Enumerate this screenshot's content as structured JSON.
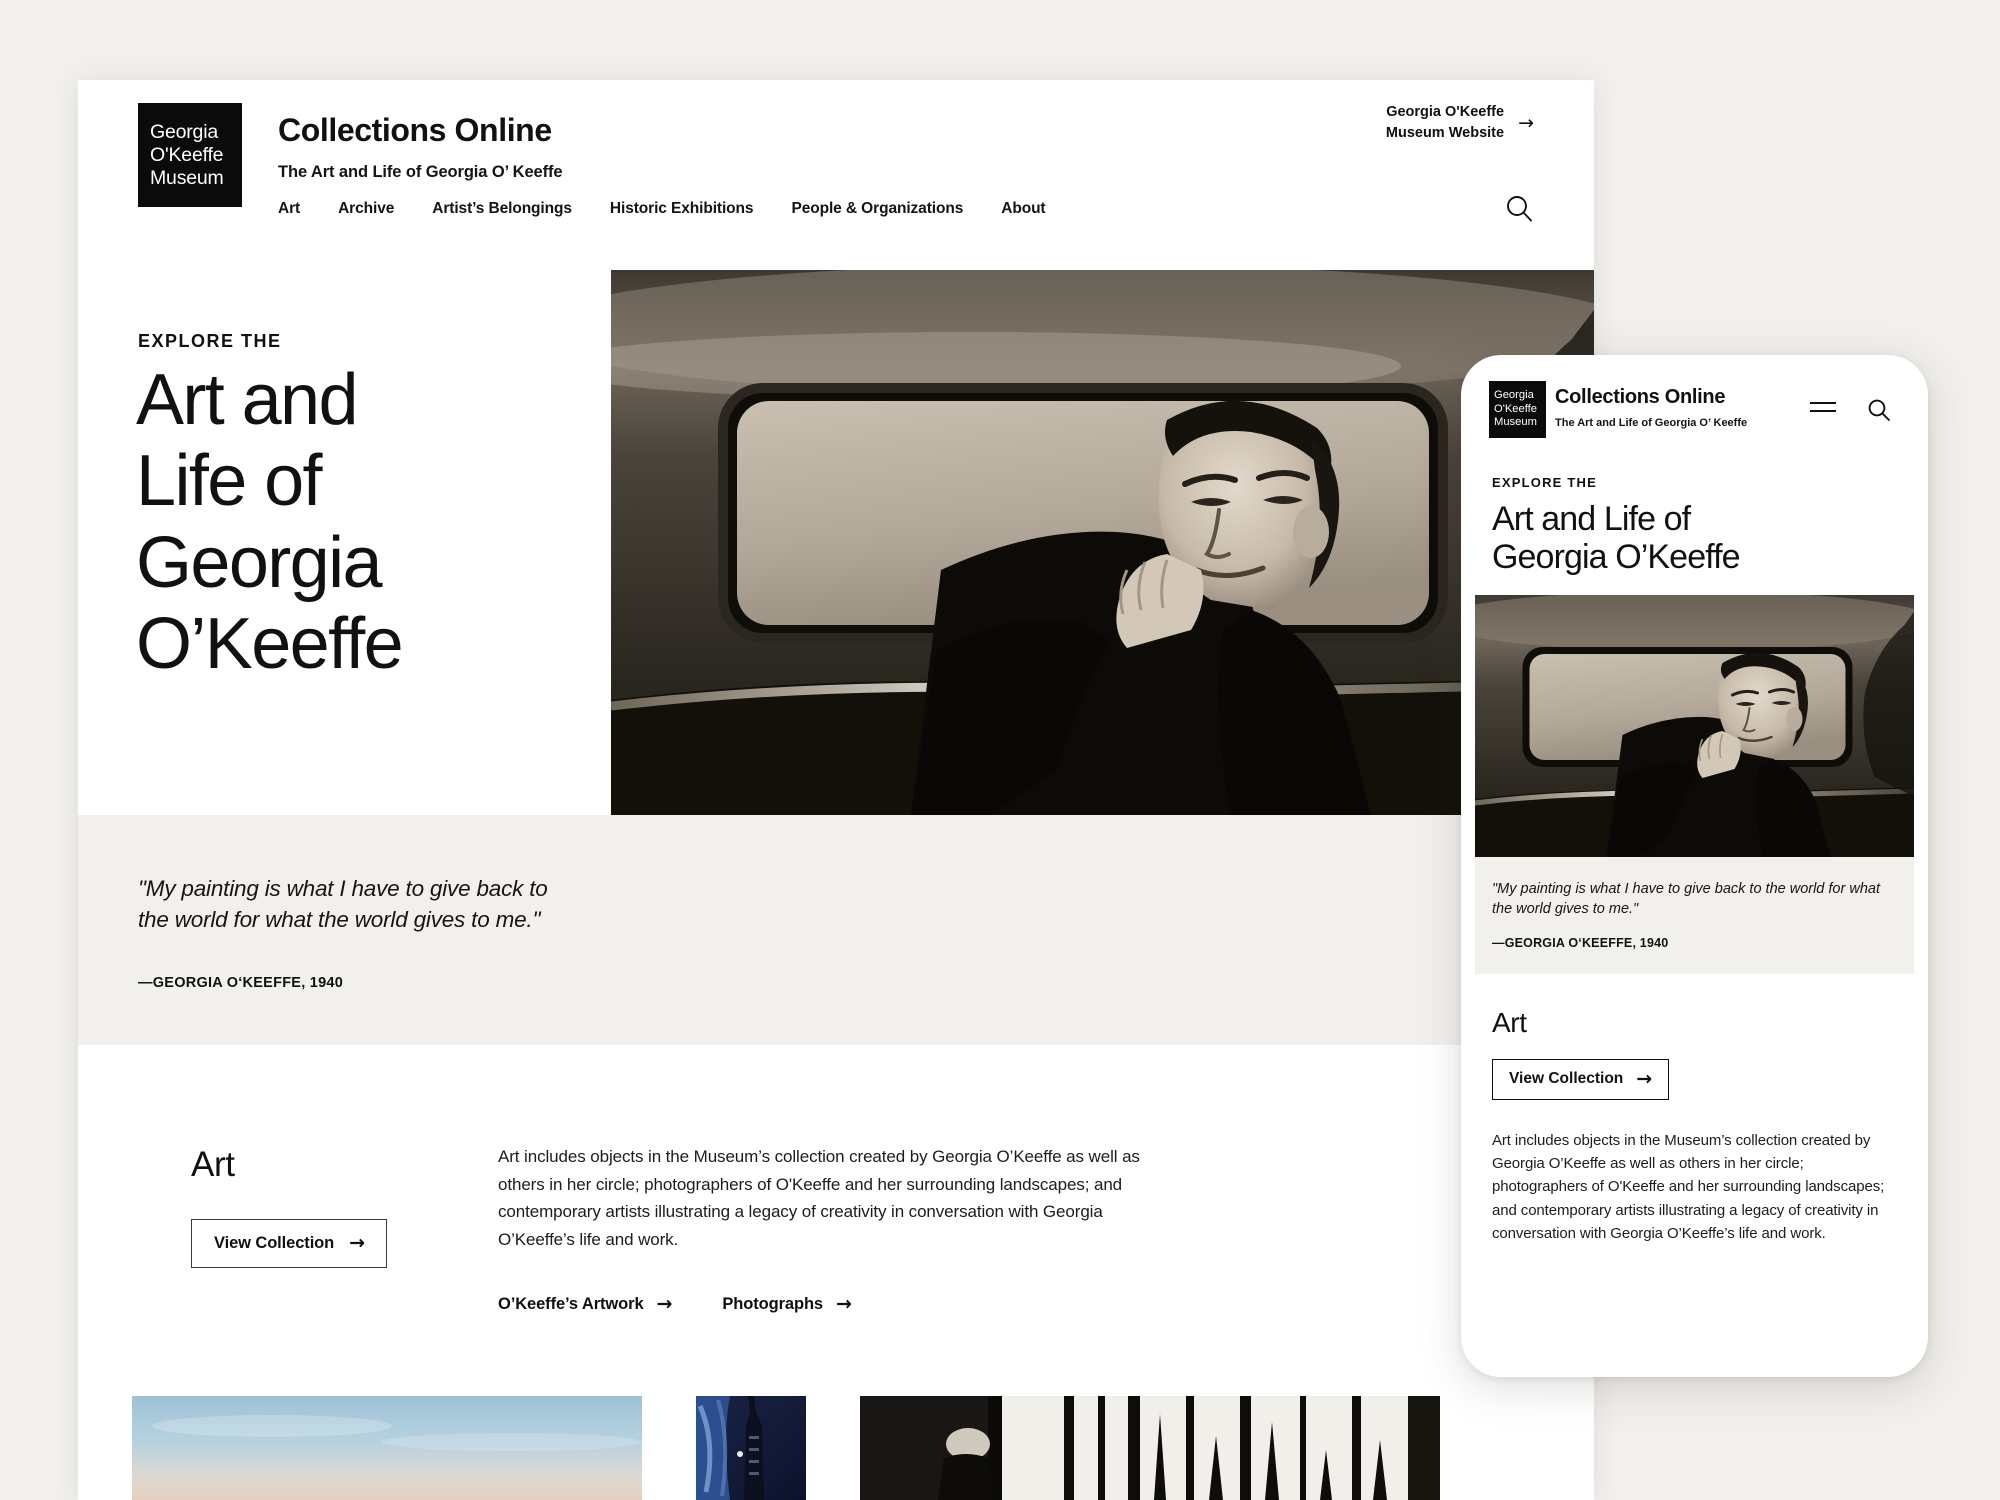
{
  "page": {
    "background_color": "#f2f0ec",
    "accent_color": "#0b0b0b"
  },
  "logo": {
    "line1": "Georgia",
    "line2": "O'Keeffe",
    "line3": "Museum"
  },
  "header": {
    "title": "Collections Online",
    "subtitle": "The Art and Life of Georgia O’ Keeffe",
    "museum_link": {
      "line1": "Georgia O'Keeffe",
      "line2": "Museum Website",
      "arrow": "→"
    },
    "search_icon": "search-icon"
  },
  "nav": {
    "items": [
      {
        "label": "Art"
      },
      {
        "label": "Archive"
      },
      {
        "label": "Artist’s Belongings"
      },
      {
        "label": "Historic Exhibitions"
      },
      {
        "label": "People & Organizations"
      },
      {
        "label": "About"
      }
    ]
  },
  "hero": {
    "eyebrow": "EXPLORE THE",
    "headline_desktop": "Art and\nLife of\nGeorgia\nO’Keeffe",
    "headline_mobile": "Art and Life of\nGeorgia O’Keeffe",
    "image_alt": "Black and white photograph of Georgia O'Keeffe seated in a car, chin resting on her hand"
  },
  "quote": {
    "text": "\"My painting is what I have to give back to the world for what the world gives to me.\"",
    "attribution": "—GEORGIA O‘KEEFFE, 1940"
  },
  "art_section": {
    "title": "Art",
    "button_label": "View Collection",
    "button_arrow": "→",
    "paragraph": "Art includes objects in the Museum’s collection created by Georgia O’Keeffe as well as others in her circle; photographers of O'Keeffe and her surrounding landscapes; and contemporary artists illustrating a legacy of creativity in conversation with Georgia O’Keeffe’s life and work.",
    "sublinks": [
      {
        "label": "O’Keeffe’s Artwork",
        "arrow": "→"
      },
      {
        "label": "Photographs",
        "arrow": "→"
      }
    ]
  },
  "thumbnails": [
    {
      "name": "landscape-sky-painting"
    },
    {
      "name": "skyscraper-night-painting"
    },
    {
      "name": "black-white-gallery-photo"
    }
  ],
  "mobile": {
    "menu_icon": "hamburger-menu-icon",
    "search_icon": "search-icon"
  }
}
